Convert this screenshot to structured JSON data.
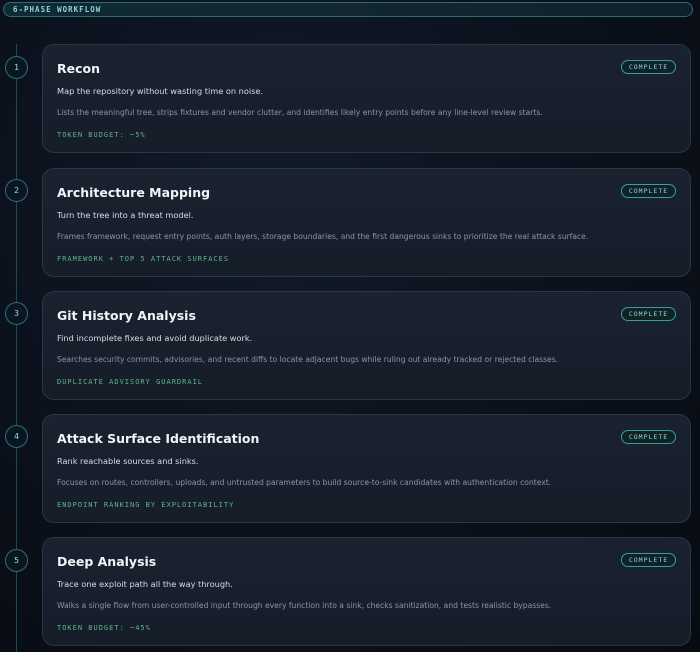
{
  "header": {
    "label": "6-PHASE WORKFLOW"
  },
  "phases": [
    {
      "number": "1",
      "title": "Recon",
      "subtitle": "Map the repository without wasting time on noise.",
      "description": "Lists the meaningful tree, strips fixtures and vendor clutter, and identifies likely entry points before any line-level review starts.",
      "tag": "TOKEN BUDGET: ~5%",
      "status": "COMPLETE"
    },
    {
      "number": "2",
      "title": "Architecture Mapping",
      "subtitle": "Turn the tree into a threat model.",
      "description": "Frames framework, request entry points, auth layers, storage boundaries, and the first dangerous sinks to prioritize the real attack surface.",
      "tag": "FRAMEWORK + TOP 5 ATTACK SURFACES",
      "status": "COMPLETE"
    },
    {
      "number": "3",
      "title": "Git History Analysis",
      "subtitle": "Find incomplete fixes and avoid duplicate work.",
      "description": "Searches security commits, advisories, and recent diffs to locate adjacent bugs while ruling out already tracked or rejected classes.",
      "tag": "DUPLICATE ADVISORY GUARDRAIL",
      "status": "COMPLETE"
    },
    {
      "number": "4",
      "title": "Attack Surface Identification",
      "subtitle": "Rank reachable sources and sinks.",
      "description": "Focuses on routes, controllers, uploads, and untrusted parameters to build source-to-sink candidates with authentication context.",
      "tag": "ENDPOINT RANKING BY EXPLOITABILITY",
      "status": "COMPLETE"
    },
    {
      "number": "5",
      "title": "Deep Analysis",
      "subtitle": "Trace one exploit path all the way through.",
      "description": "Walks a single flow from user-controlled input through every function into a sink, checks sanitization, and tests realistic bypasses.",
      "tag": "TOKEN BUDGET: ~45%",
      "status": "COMPLETE"
    }
  ]
}
